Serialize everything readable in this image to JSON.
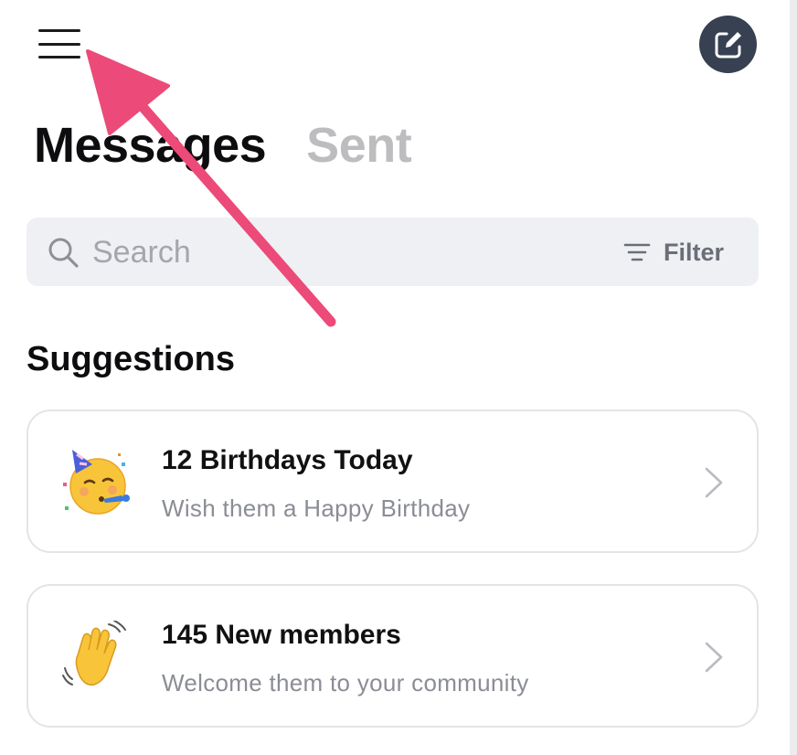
{
  "header": {
    "menu_icon": "hamburger-icon",
    "compose_icon": "compose-icon"
  },
  "tabs": [
    {
      "label": "Messages",
      "active": true
    },
    {
      "label": "Sent",
      "active": false
    }
  ],
  "search": {
    "placeholder": "Search",
    "value": "",
    "filter_label": "Filter"
  },
  "suggestions": {
    "title": "Suggestions",
    "items": [
      {
        "icon": "party-face-emoji",
        "title": "12 Birthdays Today",
        "subtitle": "Wish them a Happy Birthday"
      },
      {
        "icon": "waving-hand-emoji",
        "title": "145 New members",
        "subtitle": "Welcome them to your community"
      }
    ]
  },
  "colors": {
    "accent_arrow": "#EC4A78",
    "compose_bg": "#374151",
    "search_bg": "#EEF0F4",
    "inactive_tab": "#BDBDC0",
    "subtitle": "#8B8D95"
  }
}
